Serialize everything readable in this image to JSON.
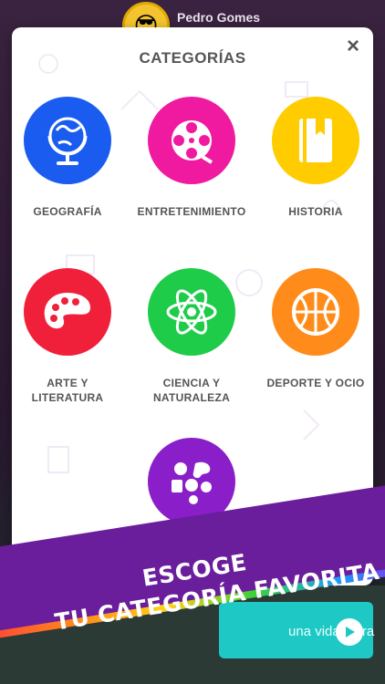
{
  "user": {
    "name": "Pedro Gomes",
    "avatar_icon": "sunglasses-emoji-icon"
  },
  "modal": {
    "title": "CATEGORÍAS",
    "close_label": "×",
    "categories": [
      {
        "label": "GEOGRAFÍA",
        "color": "#1a5cf0",
        "icon": "globe-icon"
      },
      {
        "label": "ENTRETENIMIENTO",
        "color": "#f01aa0",
        "icon": "film-reel-icon"
      },
      {
        "label": "HISTORIA",
        "color": "#ffcc00",
        "icon": "book-icon"
      },
      {
        "label": "ARTE Y\nLITERATURA",
        "color": "#f0203a",
        "icon": "palette-icon"
      },
      {
        "label": "CIENCIA Y\nNATURALEZA",
        "color": "#1ecc4a",
        "icon": "atom-icon"
      },
      {
        "label": "DEPORTE Y OCIO",
        "color": "#ff8c1a",
        "icon": "ball-icon"
      },
      {
        "label": "",
        "color": "#8a1ec8",
        "icon": "all-categories-icon"
      }
    ]
  },
  "bottom": {
    "extra_life": "una vida extra"
  },
  "banner": {
    "line1": "ESCOGE",
    "line2": "TU CATEGORÍA FAVORITA"
  }
}
